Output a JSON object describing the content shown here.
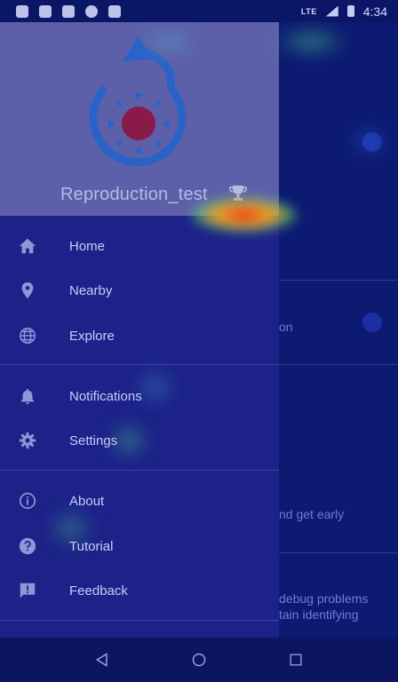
{
  "status_bar": {
    "network": "LTE",
    "time": "4:34",
    "icons": [
      "shield-icon",
      "shield-icon",
      "a-icon",
      "circle-icon",
      "sd-card-icon"
    ]
  },
  "drawer": {
    "username": "Reproduction_test",
    "items": [
      {
        "label": "Home",
        "icon": "home-icon"
      },
      {
        "label": "Nearby",
        "icon": "location-pin-icon"
      },
      {
        "label": "Explore",
        "icon": "globe-icon"
      },
      {
        "label": "Notifications",
        "icon": "bell-icon"
      },
      {
        "label": "Settings",
        "icon": "gear-icon"
      },
      {
        "label": "About",
        "icon": "info-icon"
      },
      {
        "label": "Tutorial",
        "icon": "help-icon"
      },
      {
        "label": "Feedback",
        "icon": "feedback-icon"
      }
    ]
  },
  "background": {
    "texts": [
      "on",
      "nd get early",
      "debug problems",
      "tain identifying"
    ]
  },
  "colors": {
    "drawer_bg": "#1c2288",
    "header_bg": "#5d60a8",
    "logo_blue": "#2a63c8",
    "logo_center": "#8a1a4a"
  }
}
